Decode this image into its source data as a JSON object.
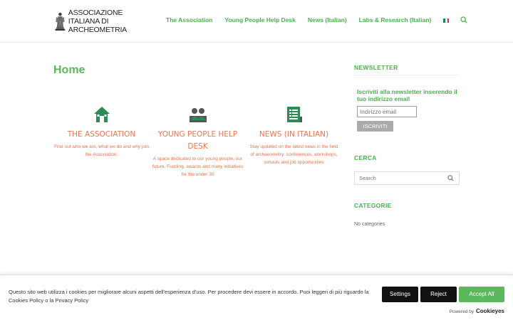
{
  "logo": {
    "lines": [
      "ASSOCIAZIONE",
      "ITALIANA DI",
      "ARCHEOMETRIA"
    ]
  },
  "nav": {
    "items": [
      "The Association",
      "Young People Help Desk",
      "News (Italian)",
      "Labs & Research (Italian)"
    ],
    "flag_colors": [
      "#009246",
      "#ffffff",
      "#ce2b37"
    ]
  },
  "page": {
    "title": "Home"
  },
  "columns": [
    {
      "icon": "house-icon",
      "title": "THE ASSOCIATION",
      "desc": "Find out who we are, what we do and why join the Association."
    },
    {
      "icon": "people-icon",
      "title": "YOUNG PEOPLE HELP DESK",
      "desc": "A space dedicated to our young people, our future. Funding, awards and many initiatives for the under 30"
    },
    {
      "icon": "newspaper-icon",
      "title": "NEWS (IN ITALIAN)",
      "desc": "Stay updated on the latest news in the field of archaeometry: conferences, workshops, schools and job opportunities"
    }
  ],
  "sidebar": {
    "newsletter_heading": "NEWSLETTER",
    "newsletter_title": "Iscriviti alla newsletter inserendo il tuo indirizzo email",
    "email_placeholder": "Indirizzo email",
    "subscribe_label": "ISCRIVITI",
    "cerca_heading": "CERCA",
    "search_placeholder": "Search",
    "categorie_heading": "CATEGORIE",
    "no_categories": "No categories"
  },
  "cookie": {
    "text": "Questo sito web utilizza i cookies per migliorare alcuni aspetti dell'esperienza d'uso. Per procedere devi essere in accordo. Puoi leggeri di più riguardo la Cookies Policy o la Privacy Policy",
    "settings_label": "Settings",
    "reject_label": "Reject",
    "accept_label": "Accept All",
    "powered_by": "Powered by",
    "brand": "Cookieyes"
  },
  "colors": {
    "accent_green": "#4caf50",
    "column_orange": "#e9754e",
    "icon_green": "#2e8b57"
  }
}
